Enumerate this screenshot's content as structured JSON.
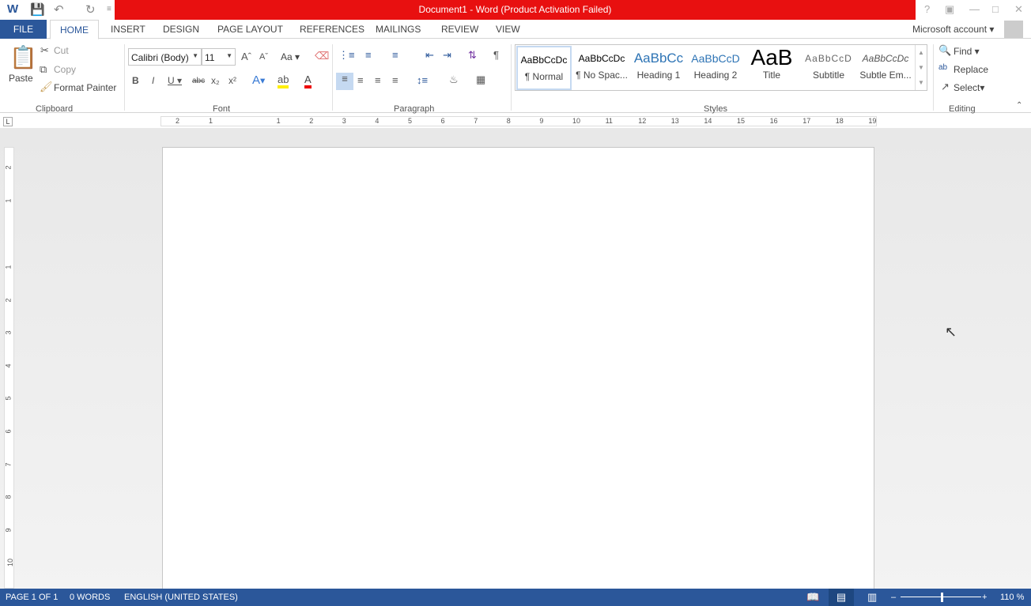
{
  "title": "Document1 -  Word (Product Activation Failed)",
  "colors": {
    "title_bar": "#e81010",
    "accent": "#2b579a"
  },
  "tabs": [
    "FILE",
    "HOME",
    "INSERT",
    "DESIGN",
    "PAGE LAYOUT",
    "REFERENCES",
    "MAILINGS",
    "REVIEW",
    "VIEW"
  ],
  "account": "Microsoft account",
  "clipboard": {
    "paste": "Paste",
    "cut": "Cut",
    "copy": "Copy",
    "format_painter": "Format Painter",
    "label": "Clipboard"
  },
  "font": {
    "name": "Calibri (Body)",
    "size": "11",
    "label": "Font",
    "change_case": "Aa"
  },
  "paragraph": {
    "label": "Paragraph"
  },
  "styles": {
    "label": "Styles",
    "items": [
      {
        "preview": "AaBbCcDc",
        "name": "¶ Normal"
      },
      {
        "preview": "AaBbCcDc",
        "name": "¶ No Spac..."
      },
      {
        "preview": "AaBbCc",
        "name": "Heading 1"
      },
      {
        "preview": "AaBbCcD",
        "name": "Heading 2"
      },
      {
        "preview": "AaB",
        "name": "Title"
      },
      {
        "preview": "AaBbCcD",
        "name": "Subtitle"
      },
      {
        "preview": "AaBbCcDc",
        "name": "Subtle Em..."
      }
    ]
  },
  "editing": {
    "find": "Find",
    "replace": "Replace",
    "select": "Select",
    "label": "Editing"
  },
  "ruler": {
    "h": [
      "2",
      "1",
      "1",
      "2",
      "3",
      "4",
      "5",
      "6",
      "7",
      "8",
      "9",
      "10",
      "11",
      "12",
      "13",
      "14",
      "15",
      "16",
      "17",
      "18",
      "19"
    ],
    "v": [
      "2",
      "1",
      "1",
      "2",
      "3",
      "4",
      "5",
      "6",
      "7",
      "8",
      "9",
      "10"
    ]
  },
  "status": {
    "page": "PAGE 1 OF 1",
    "words": "0 WORDS",
    "language": "ENGLISH (UNITED STATES)",
    "zoom": "110 %",
    "zoom_percent": 110
  }
}
